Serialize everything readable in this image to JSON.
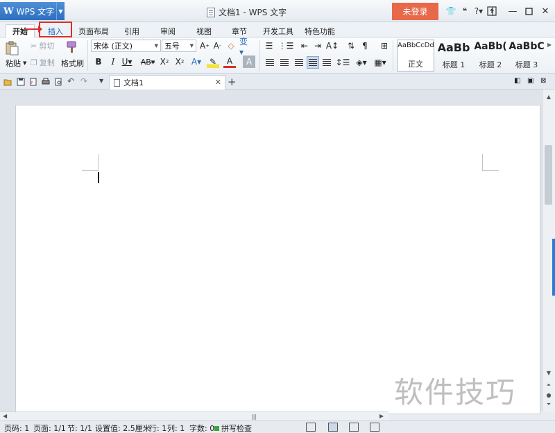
{
  "app": {
    "name": "WPS 文字",
    "window_title": "文档1 - WPS 文字",
    "login_label": "未登录"
  },
  "tabs": [
    {
      "label": "开始"
    },
    {
      "label": "插入"
    },
    {
      "label": "页面布局"
    },
    {
      "label": "引用"
    },
    {
      "label": "审阅"
    },
    {
      "label": "视图"
    },
    {
      "label": "章节"
    },
    {
      "label": "开发工具"
    },
    {
      "label": "特色功能"
    }
  ],
  "ribbon": {
    "paste": "粘贴",
    "cut": "剪切",
    "copy": "复制",
    "format_painter": "格式刷",
    "font_name": "宋体 (正文)",
    "font_size": "五号",
    "styles": [
      {
        "preview": "AaBbCcDd",
        "name": "正文"
      },
      {
        "preview": "AaBb",
        "name": "标题 1"
      },
      {
        "preview": "AaBb(",
        "name": "标题 2"
      },
      {
        "preview": "AaBbC",
        "name": "标题 3"
      }
    ]
  },
  "document": {
    "tab_title": "文档1"
  },
  "watermark": "软件技巧",
  "statusbar": {
    "page_code": "页码: 1",
    "pages": "页面: 1/1",
    "section": "节: 1/1",
    "setting": "设置值: 2.5厘米",
    "row": "行: 1",
    "col": "列: 1",
    "words": "字数: 0",
    "spell": "拼写检查"
  },
  "colors": {
    "accent": "#2d6fc0",
    "login": "#e8684a",
    "highlight_box": "#d9302a"
  }
}
